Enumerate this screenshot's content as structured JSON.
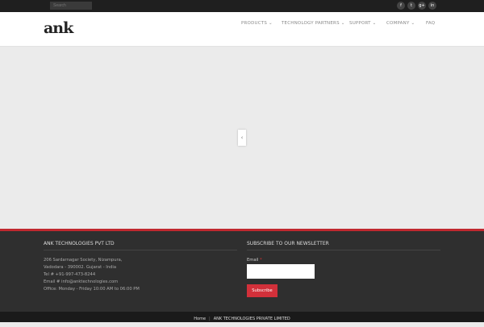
{
  "topbar": {
    "search_placeholder": "Search",
    "social": [
      {
        "icon": "facebook-icon",
        "glyph": "f"
      },
      {
        "icon": "twitter-icon",
        "glyph": "t"
      },
      {
        "icon": "google-plus-icon",
        "glyph": "g+"
      },
      {
        "icon": "linkedin-icon",
        "glyph": "in"
      }
    ]
  },
  "header": {
    "logo": "ank",
    "nav": [
      {
        "label": "PRODUCTS",
        "dropdown": "⌄"
      },
      {
        "label": "TECHNOLOGY PARTNERS",
        "dropdown": "⌄"
      },
      {
        "label": "SUPPORT",
        "dropdown": "⌄"
      },
      {
        "label": "COMPANY",
        "dropdown": "⌄"
      },
      {
        "label": "FAQ"
      }
    ]
  },
  "slider": {
    "arrow": "‹"
  },
  "footer": {
    "company_title": "ANK TECHNOLOGIES PVT LTD",
    "address": [
      "206 Sardarnagar Society, Nizampura,",
      "Vadodara - 390002. Gujarat - India",
      "Tel # +91-997-473-8244",
      "Email # info@anktechnologies.com",
      "Office: Monday - Friday 10:00 AM to 06:00 PM"
    ],
    "newsletter_title": "SUBSCRIBE TO OUR NEWSLETTER",
    "email_label": "Email",
    "email_required": "*",
    "subscribe_label": "Subscribe"
  },
  "bottombar": {
    "home": "Home",
    "separator": "|",
    "company": "ANK TECHNOLOGIES PRIVATE LIMITED"
  },
  "colors": {
    "accent": "#d2303a",
    "footer_bg": "#2f2f2f",
    "topbar_bg": "#1f1f1f"
  }
}
